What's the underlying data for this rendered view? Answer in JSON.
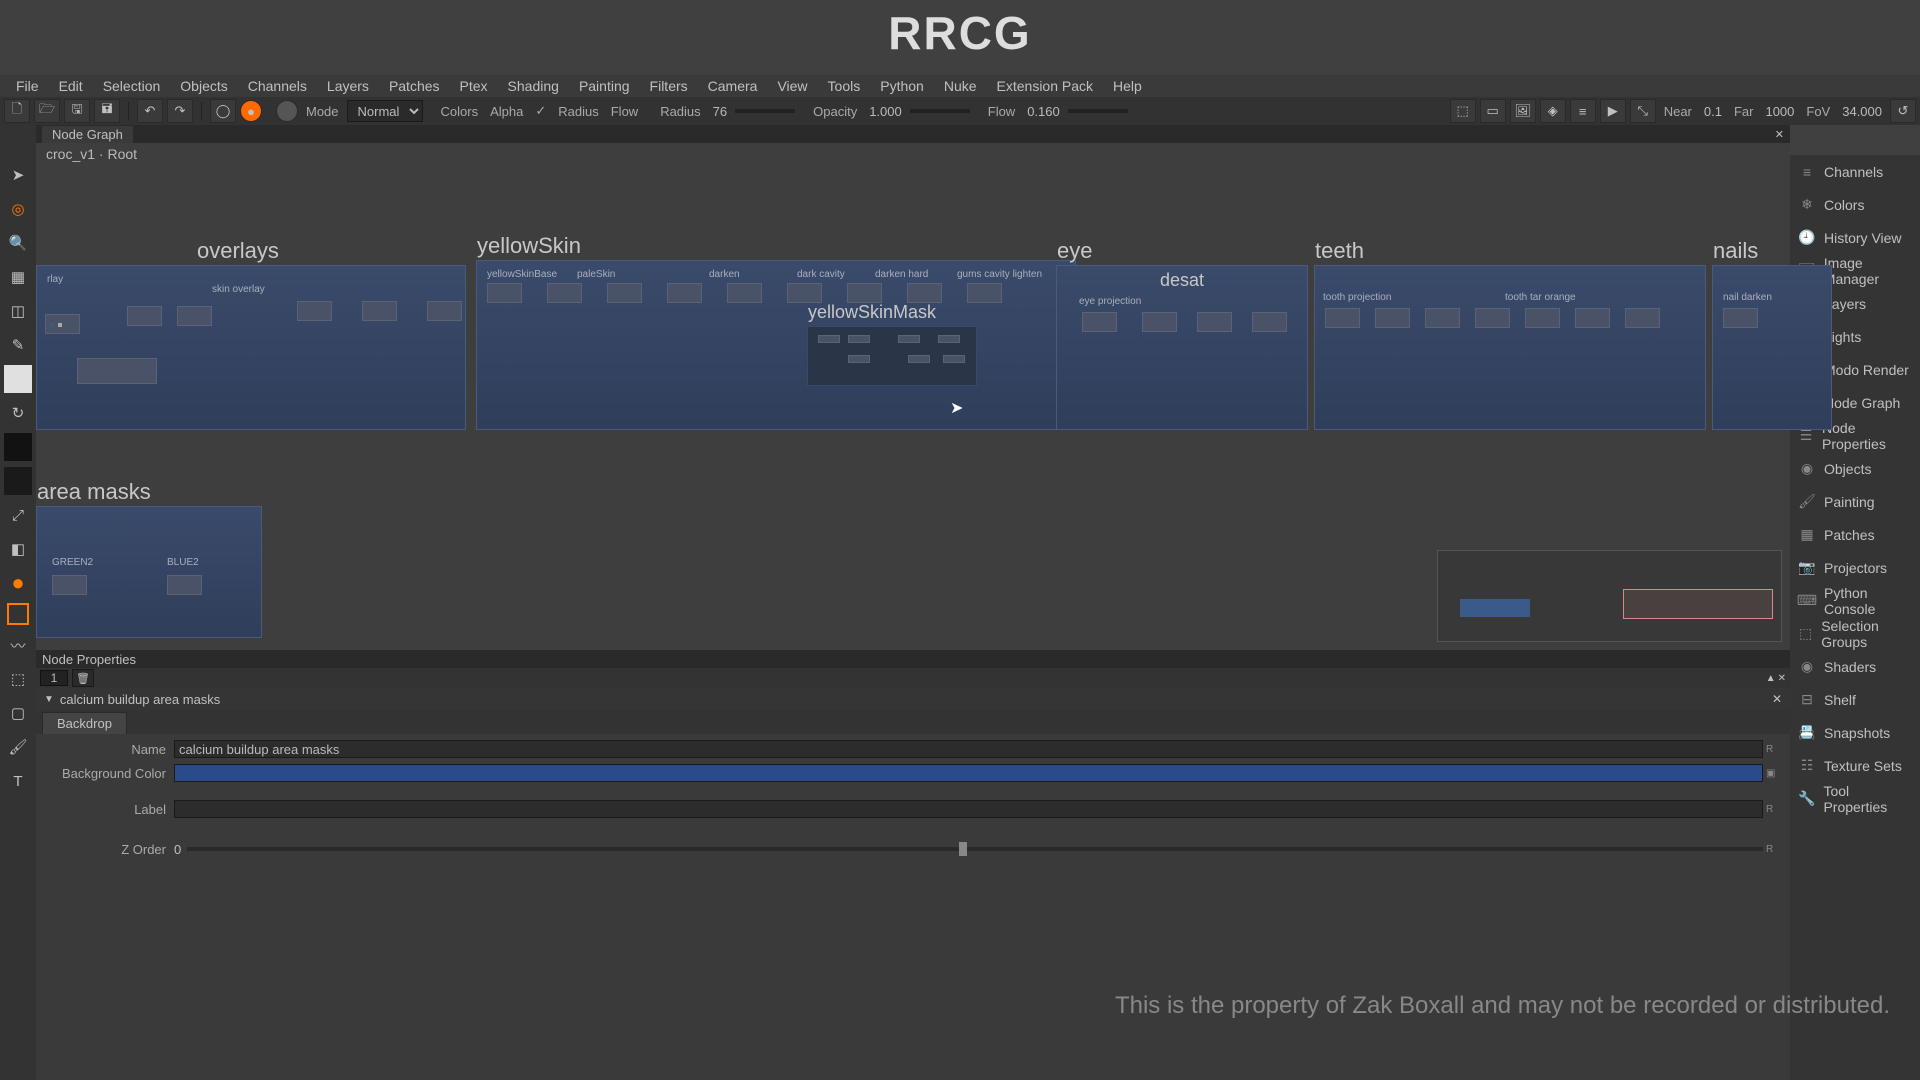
{
  "watermark": {
    "top": "RRCG",
    "disclaimer": "This is the property of Zak Boxall and may not be recorded or distributed."
  },
  "menubar": [
    "File",
    "Edit",
    "Selection",
    "Objects",
    "Channels",
    "Layers",
    "Patches",
    "Ptex",
    "Shading",
    "Painting",
    "Filters",
    "Camera",
    "View",
    "Tools",
    "Python",
    "Nuke",
    "Extension Pack",
    "Help"
  ],
  "toolbar": {
    "mode_label": "Mode",
    "mode_value": "Normal",
    "colors_label": "Colors",
    "alpha_label": "Alpha",
    "radius_label": "Radius",
    "flow_label": "Flow",
    "radius2_label": "Radius",
    "radius2_value": "76",
    "opacity_label": "Opacity",
    "opacity_value": "1.000",
    "flow2_label": "Flow",
    "flow2_value": "0.160",
    "near_label": "Near",
    "near_value": "0.1",
    "far_label": "Far",
    "far_value": "1000",
    "fov_label": "FoV",
    "fov_value": "34.000"
  },
  "graph": {
    "tab": "Node Graph",
    "breadcrumb": "croc_v1 · Root",
    "backdrops": {
      "overlays": {
        "title": "overlays",
        "inner_label": "skin overlay",
        "inner_nodes": [
          "rlay"
        ]
      },
      "yellowSkin": {
        "title": "yellowSkin",
        "nodes": [
          "yellowSkinBase",
          "paleSkin",
          "",
          "",
          "darken",
          "",
          "dark cavity",
          "darken hard",
          "gums cavity lighten"
        ],
        "mask": {
          "title": "yellowSkinMask"
        }
      },
      "eye": {
        "title": "eye",
        "sub": "desat",
        "nodes": [
          "eye projection",
          "",
          "",
          ""
        ]
      },
      "teeth": {
        "title": "teeth",
        "nodes": [
          "tooth projection",
          "",
          "",
          "",
          "tooth tar orange",
          ""
        ]
      },
      "nails": {
        "title": "nails",
        "nodes": [
          "nail darken"
        ]
      },
      "area_masks": {
        "title": "area masks",
        "nodes": [
          "GREEN2",
          "BLUE2"
        ]
      }
    }
  },
  "left_tools": [
    "pointer",
    "target",
    "magnify",
    "grid",
    "box",
    "pencil",
    "white",
    "reload",
    "black",
    "gradient",
    "eyedrop",
    "crop",
    "orange-dot",
    "orange-sq",
    "blur",
    "cube",
    "square",
    "brush",
    "text"
  ],
  "right_panels": [
    "Channels",
    "Colors",
    "History View",
    "Image Manager",
    "Layers",
    "Lights",
    "Modo Render",
    "Node Graph",
    "Node Properties",
    "Objects",
    "Painting",
    "Patches",
    "Projectors",
    "Python Console",
    "Selection Groups",
    "Shaders",
    "Shelf",
    "Snapshots",
    "Texture Sets",
    "Tool Properties"
  ],
  "properties": {
    "panel_title": "Node Properties",
    "count": "1",
    "section": "calcium buildup area masks",
    "tab": "Backdrop",
    "fields": {
      "name_label": "Name",
      "name_value": "calcium buildup area masks",
      "bg_label": "Background Color",
      "label_label": "Label",
      "label_value": "",
      "zorder_label": "Z Order",
      "zorder_value": "0"
    },
    "reset": "R"
  }
}
